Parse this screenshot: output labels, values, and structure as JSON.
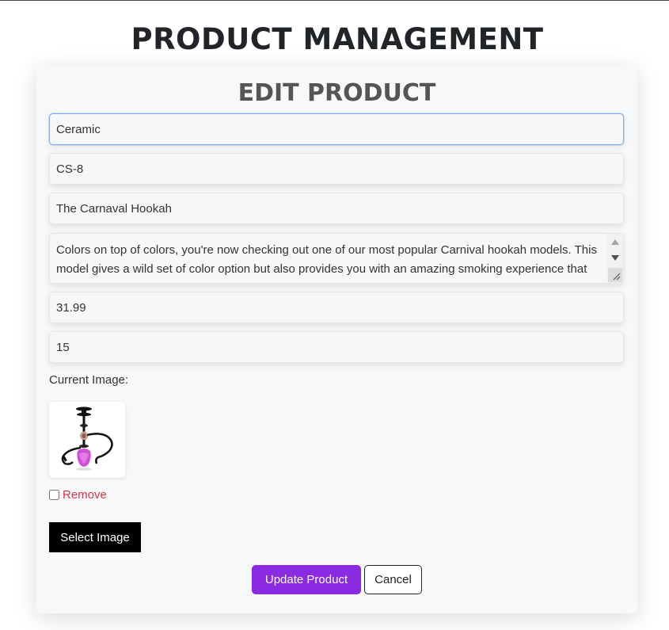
{
  "page": {
    "title": "PRODUCT MANAGEMENT"
  },
  "form": {
    "title": "EDIT PRODUCT",
    "category": "Ceramic",
    "code": "CS-8",
    "name": "The Carnaval Hookah",
    "description": "Colors on top of colors, you're now checking out one of our most popular Carnival hookah models. This model gives a wild set of color option but also provides you with an amazing smoking experience that matches the colorful look of the hookah.",
    "price": "31.99",
    "quantity": "15",
    "current_image_label": "Current Image:",
    "remove_label": "Remove",
    "select_image_label": "Select Image",
    "update_label": "Update Product",
    "cancel_label": "Cancel"
  },
  "colors": {
    "accent": "#8a2be2",
    "danger": "#dc3545",
    "select_button": "#000000"
  },
  "icons": {
    "thumbnail": "hookah-image",
    "scroll_up": "scroll-up-arrow-icon",
    "scroll_down": "scroll-down-arrow-icon",
    "resize": "resize-grip-icon"
  }
}
